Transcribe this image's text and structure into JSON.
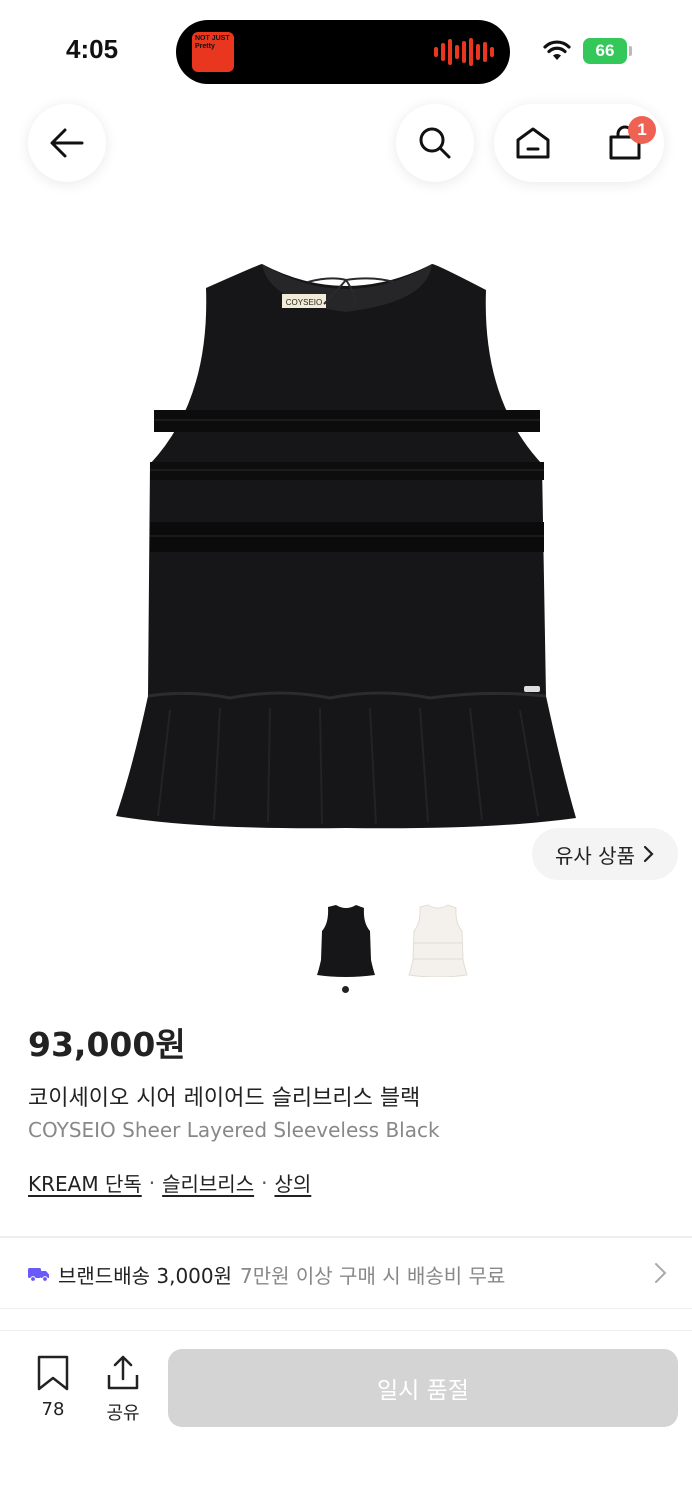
{
  "status_bar": {
    "time": "4:05",
    "battery": "66",
    "now_playing_art_text": "NOT JUST Pretty"
  },
  "header": {
    "cart_count": "1"
  },
  "gallery": {
    "similar_label": "유사 상품",
    "thumbnail_colors": [
      "black",
      "white"
    ],
    "active_index": 0
  },
  "product": {
    "price": "93,000원",
    "name_ko": "코이세이오 시어 레이어드 슬리브리스 블랙",
    "name_en": "COYSEIO Sheer Layered Sleeveless Black",
    "label_text": "COYSEIO",
    "tags": [
      "KREAM 단독",
      "슬리브리스",
      "상의"
    ],
    "tag_separator": "·"
  },
  "shipping": {
    "label": "브랜드배송 3,000원",
    "note": "7만원 이상 구매 시 배송비 무료"
  },
  "bottom_bar": {
    "bookmark_count": "78",
    "share_label": "공유",
    "buy_label": "일시 품절"
  },
  "colors": {
    "badge": "#ef6253",
    "battery": "#34c759",
    "truck_icon": "#6a5af9",
    "disabled_button": "#d4d4d4"
  }
}
